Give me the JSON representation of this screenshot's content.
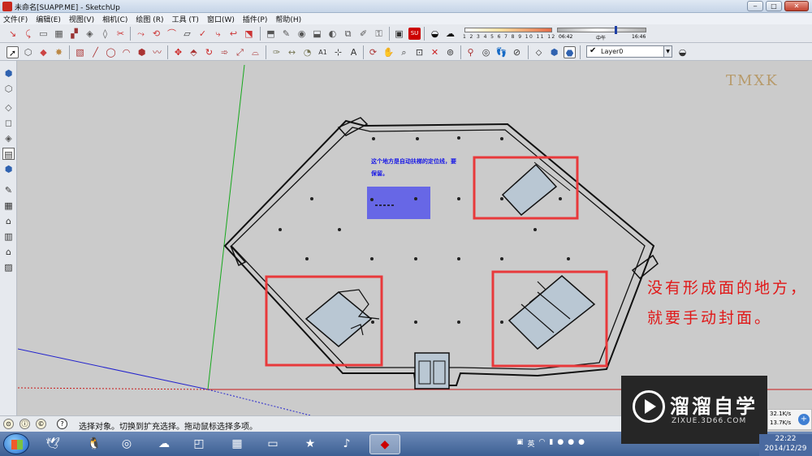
{
  "window": {
    "title": "未命名[SUAPP.ME] - SketchUp",
    "min": "‒",
    "max": "□",
    "close": "✕"
  },
  "menu": [
    "文件(F)",
    "编辑(E)",
    "视图(V)",
    "相机(C)",
    "绘图 (R)",
    "工具 (T)",
    "窗口(W)",
    "插件(P)",
    "帮助(H)"
  ],
  "shadow": {
    "months": "1 2 3 4 5 6 7 8 9 10 11 12",
    "time_start": "06:42",
    "time_noon": "中午",
    "time_end": "16:46"
  },
  "layer": {
    "name": "Layer0",
    "check": "✔"
  },
  "watermark": "TMXK",
  "annotation_blue": "这个地方是自动扶梯的定位线，要保留。",
  "annotation_red": "没有形成面的地方，就要手动封面。",
  "brand": {
    "name": "溜溜自学",
    "url": "ZIXUE.3D66.COM"
  },
  "net": {
    "up": "32.1K/s",
    "down": "13.7K/s",
    "btn": "+"
  },
  "status": {
    "text": "选择对象。切换到扩充选择。拖动鼠标选择多项。"
  },
  "clock": {
    "time": "22:22",
    "date": "2014/12/29"
  },
  "tray": [
    "英"
  ],
  "colors": {
    "red_box": "#e8393b",
    "blue_fill": "#6767e6",
    "green_axis": "#16a81c",
    "red_axis": "#c81818",
    "blue_axis": "#2222cc"
  }
}
